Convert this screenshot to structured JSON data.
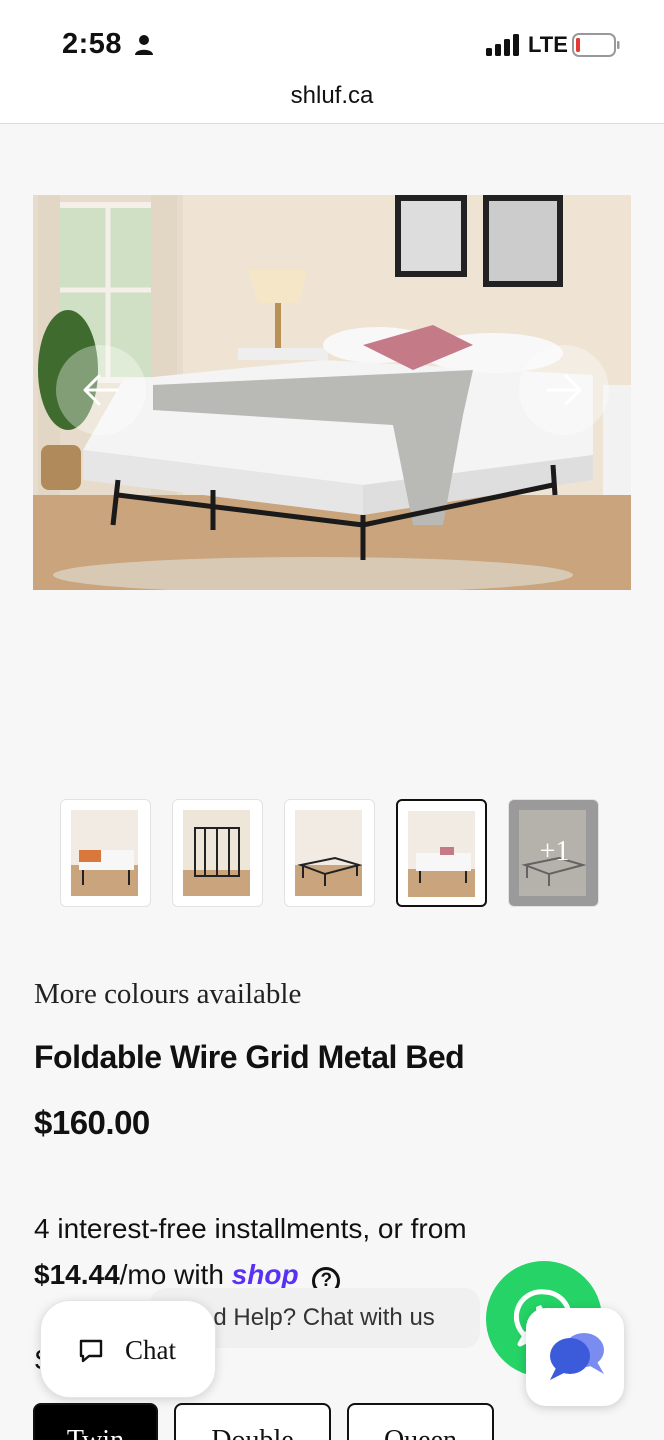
{
  "status": {
    "time": "2:58",
    "network": "LTE"
  },
  "browser": {
    "url": "shluf.ca"
  },
  "gallery": {
    "more_count": "+1"
  },
  "product": {
    "colours_note": "More colours available",
    "title": "Foldable Wire Grid Metal Bed",
    "price": "$160.00",
    "installments_prefix": "4 interest-free installments, or from",
    "installment_amount": "$14.44",
    "installment_suffix": "/mo with",
    "shop_brand": "shop",
    "help_icon_glyph": "?"
  },
  "chat": {
    "label": "Chat",
    "help_text": "ed Help? Chat with us"
  },
  "sizes": {
    "heading_initial": "S",
    "options": [
      "Twin",
      "Double",
      "Queen"
    ]
  },
  "colors": {
    "accent": "#5a31f4",
    "whatsapp": "#25d366",
    "messenger": "#3b5bdb"
  }
}
